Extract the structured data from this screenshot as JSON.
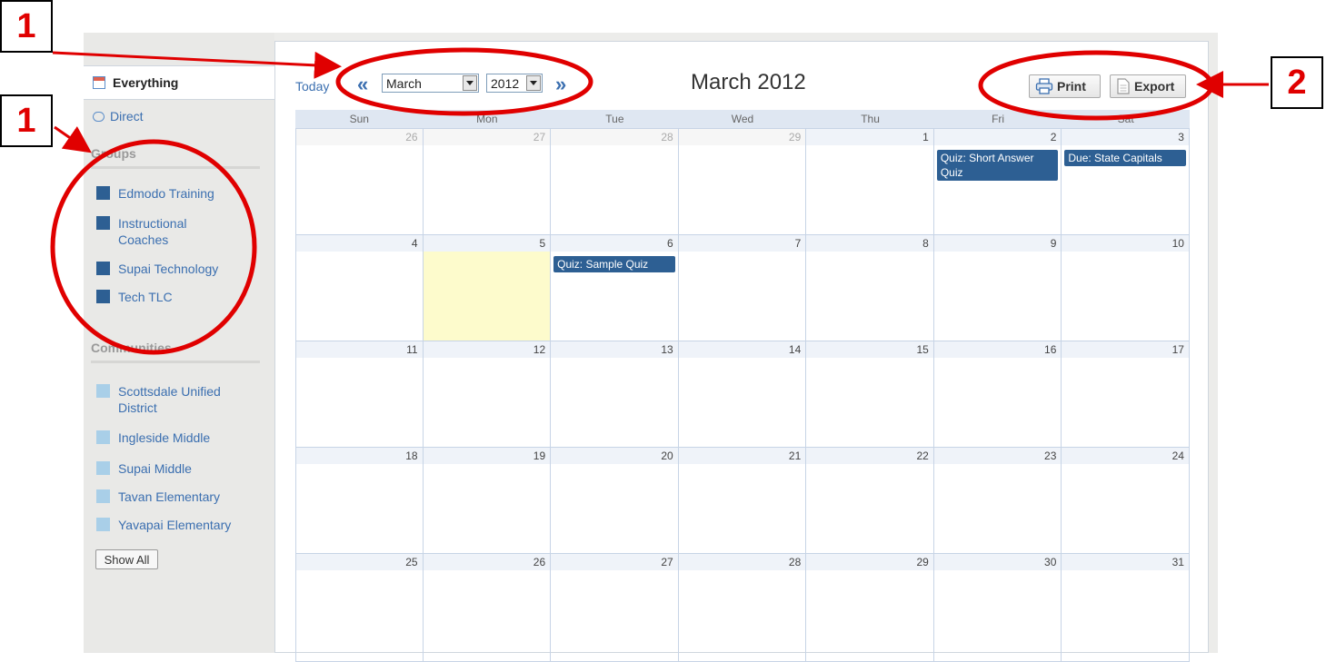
{
  "sidebar": {
    "everything_label": "Everything",
    "direct_label": "Direct",
    "groups_heading": "Groups",
    "groups": [
      {
        "label": "Edmodo Training"
      },
      {
        "label": "Instructional Coaches"
      },
      {
        "label": "Supai Technology"
      },
      {
        "label": "Tech TLC"
      }
    ],
    "communities_heading": "Communities",
    "communities": [
      {
        "label": "Scottsdale Unified District"
      },
      {
        "label": "Ingleside Middle"
      },
      {
        "label": "Supai Middle"
      },
      {
        "label": "Tavan Elementary"
      },
      {
        "label": "Yavapai Elementary"
      }
    ],
    "show_all_label": "Show All",
    "group_color": "#2d5f93",
    "community_color": "#a9cfe8"
  },
  "toolbar": {
    "today_label": "Today",
    "prev_glyph": "«",
    "next_glyph": "»",
    "month_value": "March",
    "year_value": "2012",
    "title": "March 2012",
    "print_label": "Print",
    "export_label": "Export"
  },
  "calendar": {
    "weekdays": [
      "Sun",
      "Mon",
      "Tue",
      "Wed",
      "Thu",
      "Fri",
      "Sat"
    ],
    "weeks": [
      [
        {
          "n": "26",
          "other": true
        },
        {
          "n": "27",
          "other": true
        },
        {
          "n": "28",
          "other": true
        },
        {
          "n": "29",
          "other": true
        },
        {
          "n": "1"
        },
        {
          "n": "2"
        },
        {
          "n": "3"
        }
      ],
      [
        {
          "n": "4"
        },
        {
          "n": "5",
          "today": true
        },
        {
          "n": "6"
        },
        {
          "n": "7"
        },
        {
          "n": "8"
        },
        {
          "n": "9"
        },
        {
          "n": "10"
        }
      ],
      [
        {
          "n": "11"
        },
        {
          "n": "12"
        },
        {
          "n": "13"
        },
        {
          "n": "14"
        },
        {
          "n": "15"
        },
        {
          "n": "16"
        },
        {
          "n": "17"
        }
      ],
      [
        {
          "n": "18"
        },
        {
          "n": "19"
        },
        {
          "n": "20"
        },
        {
          "n": "21"
        },
        {
          "n": "22"
        },
        {
          "n": "23"
        },
        {
          "n": "24"
        }
      ],
      [
        {
          "n": "25"
        },
        {
          "n": "26"
        },
        {
          "n": "27"
        },
        {
          "n": "28"
        },
        {
          "n": "29"
        },
        {
          "n": "30"
        },
        {
          "n": "31"
        }
      ]
    ],
    "events": [
      {
        "week": 0,
        "day": 5,
        "label": "Quiz: Short Answer Quiz"
      },
      {
        "week": 0,
        "day": 6,
        "label": "Due: State Capitals"
      },
      {
        "week": 1,
        "day": 2,
        "label": "Quiz: Sample Quiz"
      }
    ],
    "event_color": "#2d5f93",
    "today_color": "#fdfbcc"
  },
  "annotations": {
    "badges": [
      "1",
      "1",
      "2"
    ],
    "color": "#e00000"
  }
}
